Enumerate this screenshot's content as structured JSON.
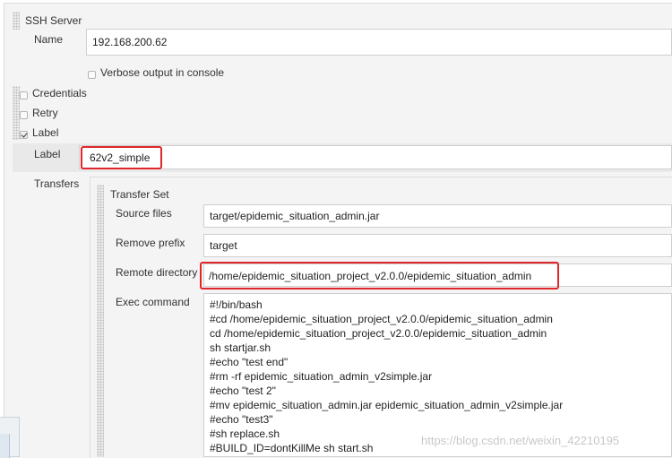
{
  "ssh_server": {
    "title": "SSH Server",
    "name_label": "Name",
    "name_value": "192.168.200.62",
    "verbose_label": "Verbose output in console",
    "verbose_checked": false
  },
  "options": {
    "credentials_label": "Credentials",
    "credentials_checked": false,
    "retry_label": "Retry",
    "retry_checked": false,
    "label_label": "Label",
    "label_checked": true
  },
  "label_field": {
    "label": "Label",
    "value": "62v2_simple"
  },
  "transfers": {
    "label": "Transfers",
    "set_title": "Transfer Set",
    "source_files_label": "Source files",
    "source_files_value": "target/epidemic_situation_admin.jar",
    "remove_prefix_label": "Remove prefix",
    "remove_prefix_value": "target",
    "remote_dir_label": "Remote directory",
    "remote_dir_value": "/home/epidemic_situation_project_v2.0.0/epidemic_situation_admin",
    "exec_label": "Exec command",
    "exec_lines": [
      "#!/bin/bash",
      "#cd /home/epidemic_situation_project_v2.0.0/epidemic_situation_admin",
      "cd /home/epidemic_situation_project_v2.0.0/epidemic_situation_admin",
      "sh startjar.sh",
      "#echo \"test end\"",
      "#rm -rf epidemic_situation_admin_v2simple.jar",
      "#echo \"test 2\"",
      "#mv epidemic_situation_admin.jar epidemic_situation_admin_v2simple.jar",
      "#echo \"test3\"",
      "#sh replace.sh",
      "#BUILD_ID=dontKillMe sh start.sh"
    ]
  },
  "watermark": "https://blog.csdn.net/weixin_42210195",
  "colors": {
    "highlight_border": "#e0262b",
    "panel_bg": "#f4f4f4",
    "label_row_bg": "#e9e9e9"
  }
}
